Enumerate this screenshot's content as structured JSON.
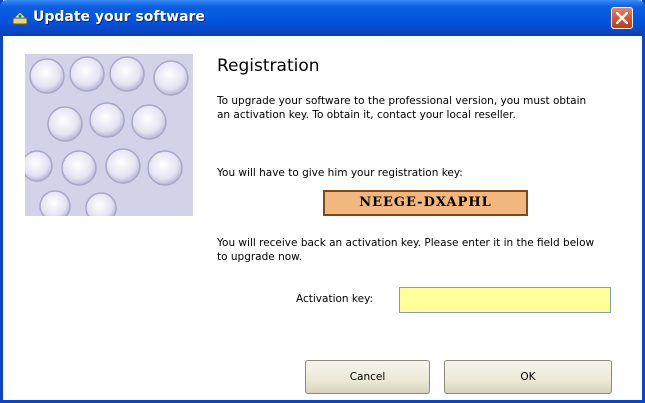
{
  "window": {
    "title": "Update your software",
    "title_bar_color": "#0454e0",
    "close_color": "#d8542e"
  },
  "registration": {
    "heading": "Registration",
    "intro": "To upgrade your software to the professional version, you must obtain an activation key. To obtain it, contact your local reseller.",
    "give_key_text": "You will have to give him your registration key:",
    "registration_key": "NEEGE-DXAPHL",
    "receive_text": "You will receive back an activation key. Please enter it in the field below to upgrade now.",
    "activation_label": "Activation key:",
    "activation_value": "",
    "key_box_color": "#f2b77f",
    "input_color": "#ffff99"
  },
  "buttons": {
    "cancel_label": "Cancel",
    "ok_label": "OK"
  },
  "icons": {
    "title": "app-icon",
    "close": "close-icon",
    "art": "keyboard-keys-art"
  }
}
